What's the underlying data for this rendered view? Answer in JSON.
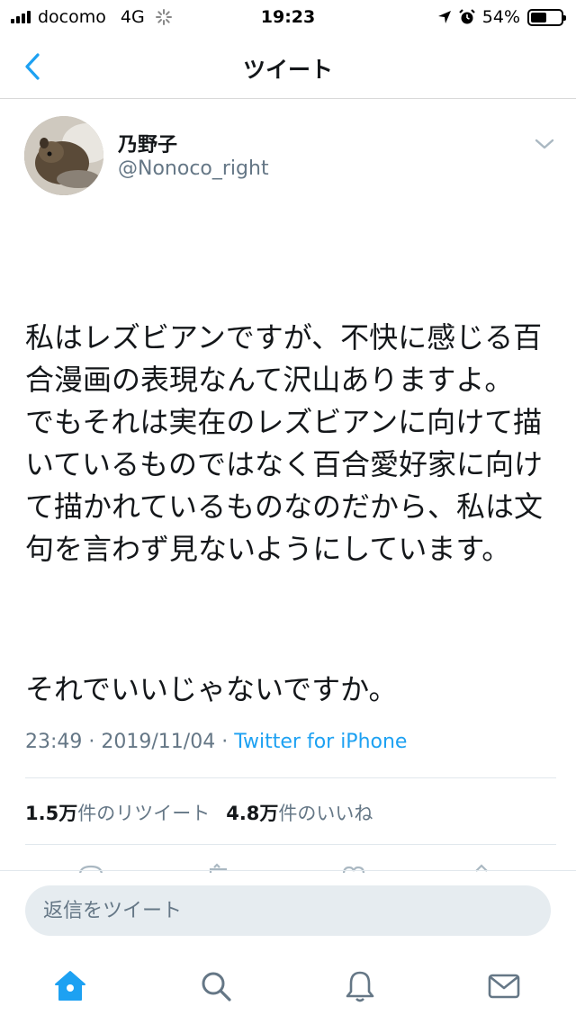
{
  "status_bar": {
    "carrier": "docomo",
    "network": "4G",
    "time": "19:23",
    "battery": "54%",
    "battery_level": 0.54
  },
  "nav": {
    "title": "ツイート"
  },
  "tweet": {
    "author_name": "乃野子",
    "author_handle": "@Nonoco_right",
    "text_p1": "私はレズビアンですが、不快に感じる百合漫画の表現なんて沢山ありますよ。\nでもそれは実在のレズビアンに向けて描いているものではなく百合愛好家に向けて描かれているものなのだから、私は文句を言わず見ないようにしています。",
    "text_p2": "それでいいじゃないですか。",
    "time": "23:49",
    "date": "2019/11/04",
    "separator": "·",
    "source": "Twitter for iPhone",
    "retweet_count": "1.5万",
    "retweet_label": "件のリツイート",
    "like_count": "4.8万",
    "like_label": "件のいいね"
  },
  "reply": {
    "placeholder": "返信をツイート"
  },
  "tabs": {
    "active_color": "#1da1f2",
    "inactive_color": "#657786"
  }
}
